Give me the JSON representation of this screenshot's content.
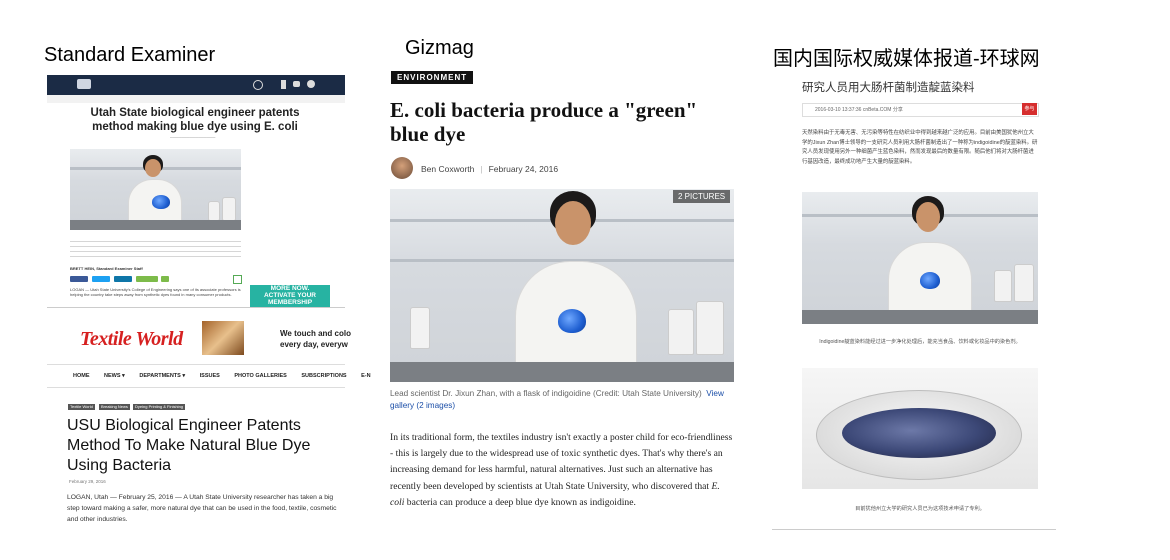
{
  "labels": {
    "panel1": "Standard Examiner",
    "panel2": "Gizmag",
    "panel3": "国内国际权威媒体报道-环球网"
  },
  "standard_examiner": {
    "title": "Utah State biological engineer patents method making blue dye using E. coli",
    "byline": "BRETT HEIN, Standard Examiner Staff",
    "share_buttons": [
      "SHARE",
      "TWEET",
      "SHARE",
      "EMAIL"
    ],
    "intro": "LOGAN — Utah State University's College of Engineering says one of its associate professors is helping the country take steps away from synthetic dyes found in many consumer products.",
    "ad": {
      "line1": "MORE NOW.",
      "line2": "ACTIVATE YOUR",
      "line3": "MEMBERSHIP"
    }
  },
  "textile_world": {
    "logo": "Textile World",
    "ad_text": [
      "We touch and colo",
      "every day, everyw"
    ],
    "nav": [
      "HOME",
      "NEWS ▾",
      "DEPARTMENTS ▾",
      "ISSUES",
      "PHOTO GALLERIES",
      "SUBSCRIPTIONS",
      "E-N"
    ],
    "tags": [
      "Textile World",
      "Breaking News",
      "Dyeing Printing & Finishing"
    ],
    "title": "USU Biological Engineer Patents Method To Make Natural Blue Dye Using Bacteria",
    "date": "February 29, 2016",
    "body": "LOGAN, Utah — February 25, 2016 — A Utah State University researcher has taken a big step toward making a safer, more natural dye that can be used in the food, textile, cosmetic and other industries."
  },
  "gizmag": {
    "section": "ENVIRONMENT",
    "title": "E. coli bacteria produce a \"green\" blue dye",
    "author": "Ben Coxworth",
    "date": "February 24, 2016",
    "pictures": "2 PICTURES",
    "caption": "Lead scientist Dr. Jixun Zhan, with a flask of indigoidine (Credit: Utah State University)",
    "caption_link": "View gallery (2 images)",
    "body_1": "In its traditional form, the textiles industry isn't exactly a poster child for eco-friendliness - this is largely due to the widespread use of toxic synthetic dyes. That's why there's an increasing demand for less harmful, natural alternatives. Just such an alternative has recently been developed by scientists at Utah State University, who discovered that ",
    "body_italic": "E. coli",
    "body_2": " bacteria can produce a deep blue dye known as indigoidine."
  },
  "huanqiu": {
    "headline": "研究人员用大肠杆菌制造靛蓝染料",
    "meta": "2016-03-10 13:37:36   cnBeta.COM   分享",
    "badge": "参与",
    "paragraph": "天然染料由于无毒无害、无污染等特性在纺织业中得到越来越广泛的应用。目前由美国犹他州立大学的Jixun Zhan博士领导的一支研究人员利用大肠杆菌制造出了一种称为indigoidine的靛蓝染料。研究人员发现使用另外一种细菌产生蓝色染料，然而发现最后的数量有限。随后他们将对大肠杆菌进行基因改造，最终成功地产生大量的靛蓝染料。",
    "caption1": "Indigoidine靛蓝染料能经过进一步净化处理后，能充当食品、饮料或化妆品中的染色剂。",
    "caption2": "目前犹他州立大学的研究人员已为这项技术申请了专利。"
  }
}
